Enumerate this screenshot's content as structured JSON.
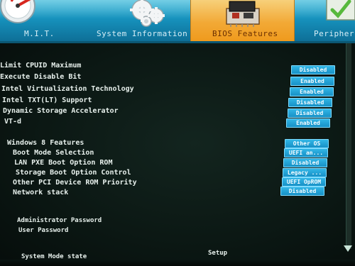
{
  "nav": {
    "tabs": [
      {
        "label": "M.I.T.",
        "icon": "speedometer-icon"
      },
      {
        "label": "System Information",
        "icon": "gears-icon"
      },
      {
        "label": "BIOS Features",
        "icon": "bios-chip-icon",
        "active": true
      },
      {
        "label": "Peripher",
        "icon": "peripherals-icon"
      }
    ]
  },
  "settings": [
    {
      "label": "Limit CPUID Maximum",
      "value": "Disabled"
    },
    {
      "label": "Execute Disable Bit",
      "value": "Enabled"
    },
    {
      "label": "Intel Virtualization Technology",
      "value": "Enabled"
    },
    {
      "label": "Intel TXT(LT) Support",
      "value": "Disabled"
    },
    {
      "label": "Dynamic Storage Accelerator",
      "value": "Disabled"
    },
    {
      "label": "VT-d",
      "value": "Enabled"
    },
    {
      "label": "Windows 8 Features",
      "value": "Other OS"
    },
    {
      "label": "Boot Mode Selection",
      "value": "UEFI an..."
    },
    {
      "label": "LAN PXE Boot Option ROM",
      "value": "Disabled"
    },
    {
      "label": "Storage Boot Option Control",
      "value": "Legacy ..."
    },
    {
      "label": "Other PCI Device ROM Priority",
      "value": "UEFI OpROM"
    },
    {
      "label": "Network stack",
      "value": "Disabled"
    }
  ],
  "passwords": {
    "admin_label": "Administrator Password",
    "user_label": "User Password"
  },
  "status": {
    "label": "System Mode state",
    "value": "Setup"
  },
  "colors": {
    "background": "#0a1512",
    "topbar": "#1690bb",
    "active_tab": "#f2a936",
    "value_button": "#1f9fd6",
    "text": "#e7f0ec"
  }
}
